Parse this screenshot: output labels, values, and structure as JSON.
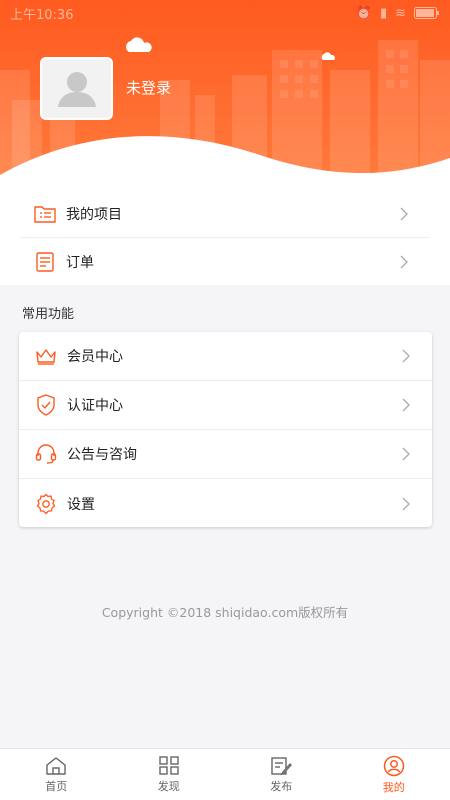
{
  "status_bar": {
    "time": "上午10:36"
  },
  "profile": {
    "username": "未登录"
  },
  "top_menu": [
    {
      "label": "我的项目",
      "icon": "folder-list-icon"
    },
    {
      "label": "订单",
      "icon": "document-icon"
    }
  ],
  "section": {
    "title": "常用功能"
  },
  "functions": [
    {
      "label": "会员中心",
      "icon": "crown-icon"
    },
    {
      "label": "认证中心",
      "icon": "shield-check-icon"
    },
    {
      "label": "公告与咨询",
      "icon": "headset-icon"
    },
    {
      "label": "设置",
      "icon": "gear-icon"
    }
  ],
  "footer": {
    "copyright": "Copyright ©2018 shiqidao.com版权所有"
  },
  "tabbar": [
    {
      "label": "首页",
      "icon": "home-icon",
      "active": false
    },
    {
      "label": "发现",
      "icon": "grid-icon",
      "active": false
    },
    {
      "label": "发布",
      "icon": "edit-icon",
      "active": false
    },
    {
      "label": "我的",
      "icon": "user-circle-icon",
      "active": true
    }
  ],
  "colors": {
    "accent": "#ff5a1f",
    "header": "#ff6e31"
  }
}
